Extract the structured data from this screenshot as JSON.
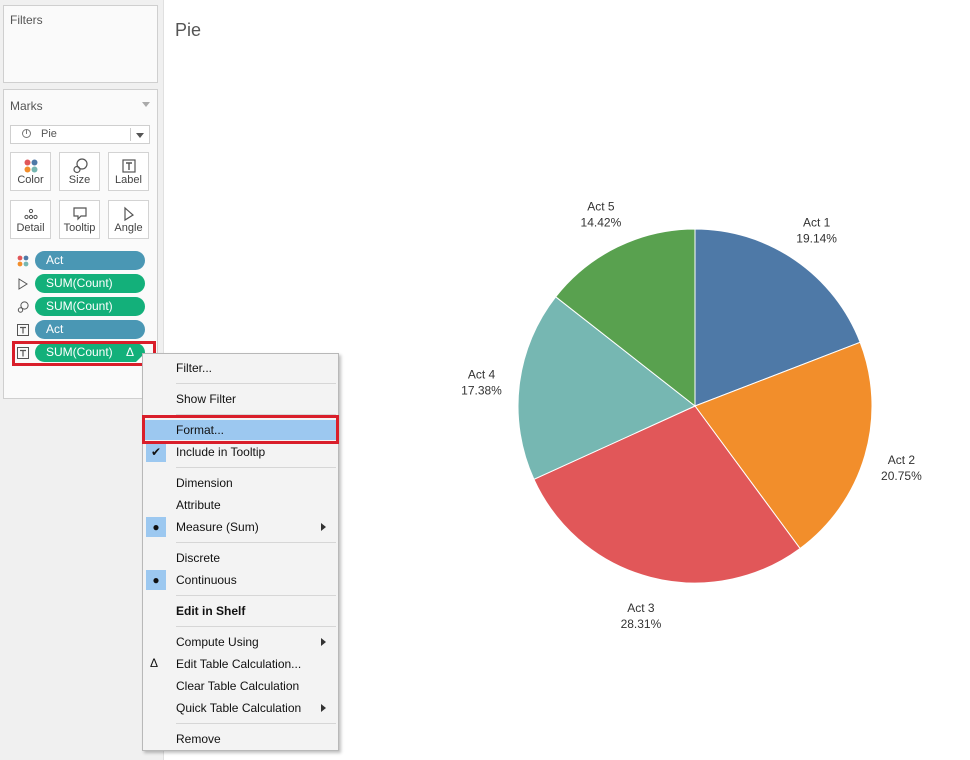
{
  "filters_panel": {
    "title": "Filters"
  },
  "marks_panel": {
    "title": "Marks",
    "mark_type": "Pie",
    "buttons": [
      {
        "label": "Color",
        "icon": "color-dots-icon"
      },
      {
        "label": "Size",
        "icon": "size-icon"
      },
      {
        "label": "Label",
        "icon": "label-t-icon"
      },
      {
        "label": "Detail",
        "icon": "detail-dots-icon"
      },
      {
        "label": "Tooltip",
        "icon": "tooltip-icon"
      },
      {
        "label": "Angle",
        "icon": "angle-icon"
      }
    ],
    "pills": [
      {
        "label": "Act",
        "type": "dimension",
        "encoding": "color"
      },
      {
        "label": "SUM(Count)",
        "type": "measure",
        "encoding": "angle"
      },
      {
        "label": "SUM(Count)",
        "type": "measure",
        "encoding": "size"
      },
      {
        "label": "Act",
        "type": "dimension",
        "encoding": "label"
      },
      {
        "label": "SUM(Count)",
        "type": "measure",
        "encoding": "label",
        "table_calc_mark": "Δ"
      }
    ]
  },
  "sheet": {
    "title": "Pie"
  },
  "context_menu": {
    "items": [
      {
        "label": "Filter..."
      },
      {
        "label": "Show Filter"
      },
      {
        "label": "Format...",
        "selected": true
      },
      {
        "label": "Include in Tooltip",
        "checked": "✔"
      },
      {
        "label": "Dimension"
      },
      {
        "label": "Attribute"
      },
      {
        "label": "Measure (Sum)",
        "checked": "●",
        "submenu": true
      },
      {
        "label": "Discrete"
      },
      {
        "label": "Continuous",
        "checked": "●"
      },
      {
        "label": "Edit in Shelf",
        "bold": true
      },
      {
        "label": "Compute Using",
        "submenu": true
      },
      {
        "label": "Edit Table Calculation...",
        "glyph": "Δ"
      },
      {
        "label": "Clear Table Calculation"
      },
      {
        "label": "Quick Table Calculation",
        "submenu": true
      },
      {
        "label": "Remove"
      }
    ]
  },
  "colors": {
    "dimension_pill": "#4a97b4",
    "measure_pill": "#13b07a",
    "highlight": "#d91e2a",
    "menu_selection": "#9cc8f0"
  },
  "chart_data": {
    "type": "pie",
    "categories": [
      "Act 1",
      "Act 2",
      "Act 3",
      "Act 4",
      "Act 5"
    ],
    "values": [
      19.14,
      20.75,
      28.31,
      17.38,
      14.42
    ],
    "value_labels": [
      "19.14%",
      "20.75%",
      "28.31%",
      "17.38%",
      "14.42%"
    ],
    "colors": [
      "#4e79a7",
      "#f28e2b",
      "#e15759",
      "#76b7b2",
      "#59a14f"
    ]
  }
}
